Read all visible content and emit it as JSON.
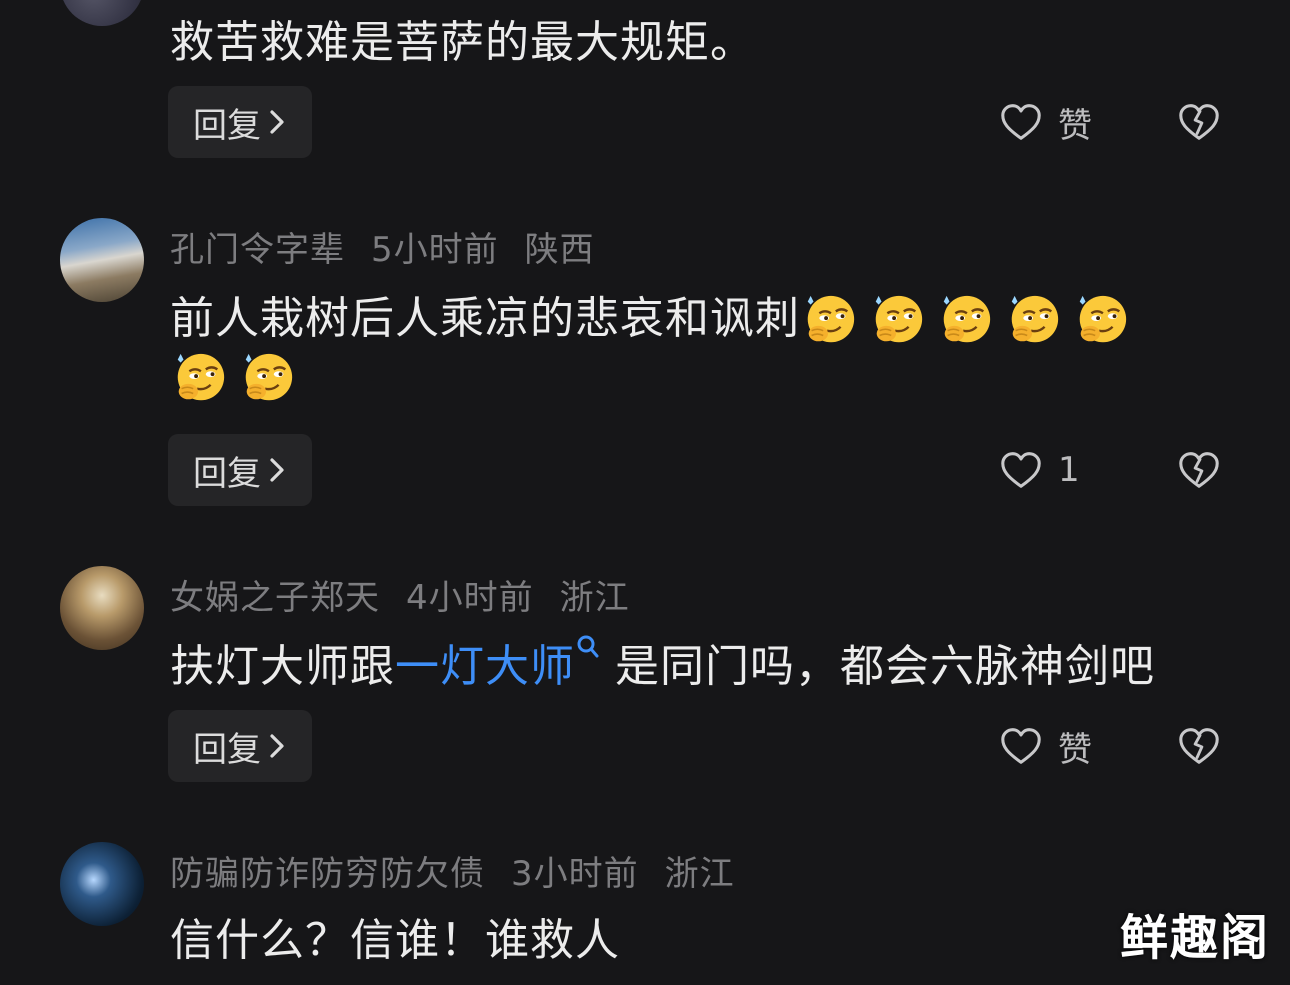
{
  "comments": [
    {
      "text": "救苦救难是菩萨的最大规矩。",
      "reply_label": "回复",
      "like_label": "赞"
    },
    {
      "username": "孔门令字辈",
      "time": "5小时前",
      "location": "陕西",
      "text": "前人栽树后人乘凉的悲哀和讽刺",
      "emoji_icon": "smirk-emoji-icon",
      "emoji_count": 7,
      "reply_label": "回复",
      "like_label": "1"
    },
    {
      "username": "女娲之子郑天",
      "time": "4小时前",
      "location": "浙江",
      "text_before": "扶灯大师跟",
      "text_link": "一灯大师",
      "text_after": "是同门吗，都会六脉神剑吧",
      "reply_label": "回复",
      "like_label": "赞"
    },
    {
      "username": "防骗防诈防穷防欠债",
      "time": "3小时前",
      "location": "浙江",
      "text": "信什么？信谁！谁救人"
    }
  ],
  "watermark": "鲜趣阁",
  "colors": {
    "background": "#161618",
    "meta_text": "#7d7d80",
    "link": "#3e8ef7",
    "reply_button_bg": "#252527"
  }
}
